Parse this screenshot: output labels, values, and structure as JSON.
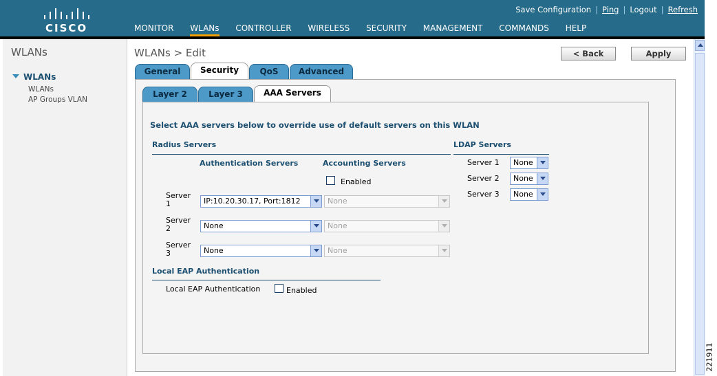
{
  "header": {
    "logo_text": "CISCO",
    "top_links": [
      "Save Configuration",
      "Ping",
      "Logout",
      "Refresh"
    ],
    "nav": [
      "MONITOR",
      "WLANs",
      "CONTROLLER",
      "WIRELESS",
      "SECURITY",
      "MANAGEMENT",
      "COMMANDS",
      "HELP"
    ],
    "active_nav": "WLANs"
  },
  "sidebar": {
    "title": "WLANs",
    "group": "WLANs",
    "items": [
      "WLANs",
      "AP Groups VLAN"
    ]
  },
  "page": {
    "title": "WLANs > Edit",
    "back_label": "< Back",
    "apply_label": "Apply",
    "tabs": [
      "General",
      "Security",
      "QoS",
      "Advanced"
    ],
    "active_tab": "Security",
    "subtabs": [
      "Layer 2",
      "Layer 3",
      "AAA Servers"
    ],
    "active_subtab": "AAA Servers"
  },
  "aaa": {
    "intro": "Select AAA servers below to override use of default servers on this WLAN",
    "radius_header": "Radius Servers",
    "auth_header": "Authentication Servers",
    "acct_header": "Accounting Servers",
    "acct_enabled_label": "Enabled",
    "acct_enabled": false,
    "servers": [
      {
        "label": "Server 1",
        "auth": "IP:10.20.30.17, Port:1812",
        "acct": "None"
      },
      {
        "label": "Server 2",
        "auth": "None",
        "acct": "None"
      },
      {
        "label": "Server 3",
        "auth": "None",
        "acct": "None"
      }
    ],
    "ldap_header": "LDAP Servers",
    "ldap_servers": [
      {
        "label": "Server 1",
        "value": "None"
      },
      {
        "label": "Server 2",
        "value": "None"
      },
      {
        "label": "Server 3",
        "value": "None"
      }
    ],
    "local_eap_header": "Local EAP Authentication",
    "local_eap_label": "Local EAP Authentication",
    "local_eap_enabled_label": "Enabled",
    "local_eap_enabled": false
  },
  "figure_id": "221911",
  "colors": {
    "header_bg": "#276b8a",
    "tab_blue": "#4d9ac8",
    "heading_blue": "#1c4f70",
    "nav_accent": "#f2a100"
  }
}
